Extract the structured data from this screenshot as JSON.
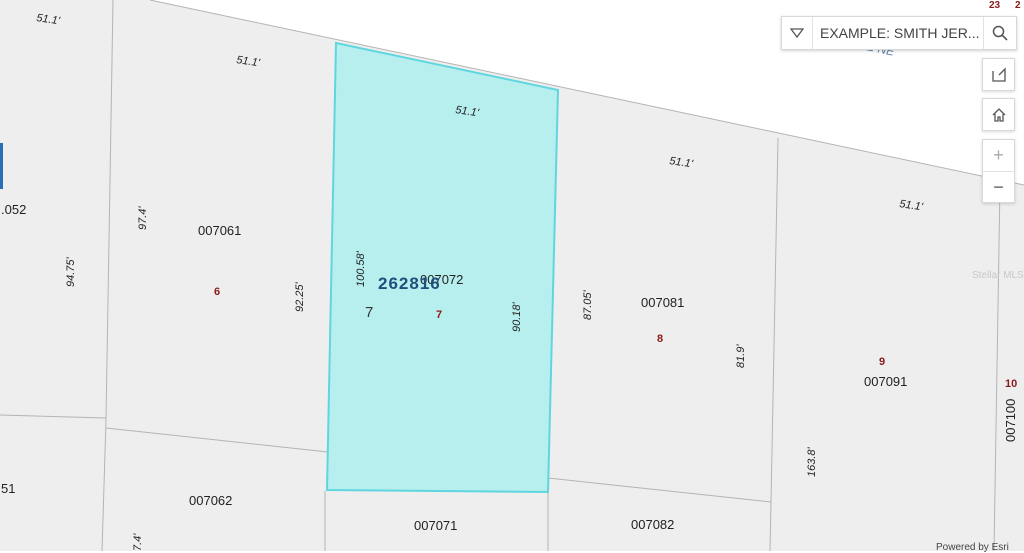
{
  "search": {
    "placeholder": "EXAMPLE: SMITH JER..."
  },
  "controls": {
    "dropdown_icon": "triangle-down-icon",
    "search_icon": "magnifier-icon",
    "basemap_icon": "map-fold-icon",
    "home_icon": "home-icon",
    "zoom_in": "+",
    "zoom_out": "−"
  },
  "selected_parcel": {
    "id": "262816",
    "fill": "#b7efef",
    "stroke": "#5fd6df"
  },
  "road_label": "E NE",
  "watermark": "Stellar MLS",
  "parcel_ids": [
    "007061",
    "007072",
    "007081",
    "007091",
    "007062",
    "007071",
    "007082",
    "007100"
  ],
  "partial_ids": [
    ".052",
    "51"
  ],
  "lot_numbers": [
    "6",
    "7",
    "8",
    "9",
    "10"
  ],
  "lot_label_large": "7",
  "dimensions": [
    "51.1'",
    "51.1'",
    "51.1'",
    "51.1'",
    "51.1'",
    "97.4'",
    "94.75'",
    "92.25'",
    "100.58'",
    "90.18'",
    "87.05'",
    "81.9'",
    "163.8'",
    "7.4'"
  ],
  "corner_labels": [
    "23",
    "2"
  ],
  "attribution": "Powered by Esri"
}
